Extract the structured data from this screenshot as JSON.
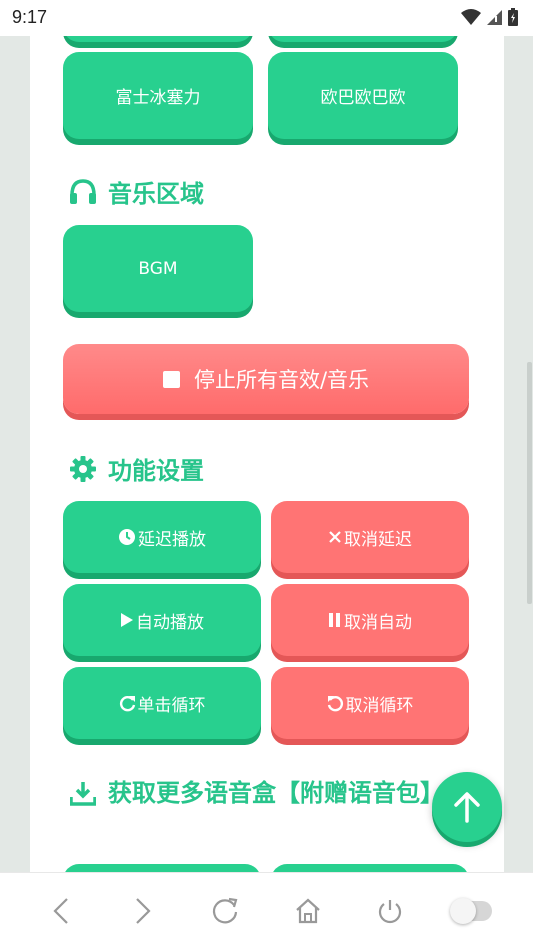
{
  "status": {
    "time": "9:17"
  },
  "buttons_top": [
    "富士冰塞力",
    "欧巴欧巴欧"
  ],
  "music": {
    "title": "音乐区域",
    "bgm": "BGM"
  },
  "stop_all": "停止所有音效/音乐",
  "settings": {
    "title": "功能设置",
    "delay_play": "延迟播放",
    "cancel_delay": "取消延迟",
    "auto_play": "自动播放",
    "cancel_auto": "取消自动",
    "loop_once": "单击循环",
    "cancel_loop": "取消循环"
  },
  "more": {
    "title": "获取更多语音盒【附赠语音包】"
  },
  "colors": {
    "green": "#28d08f",
    "red": "#ff7474",
    "title_green": "#27c48b"
  }
}
